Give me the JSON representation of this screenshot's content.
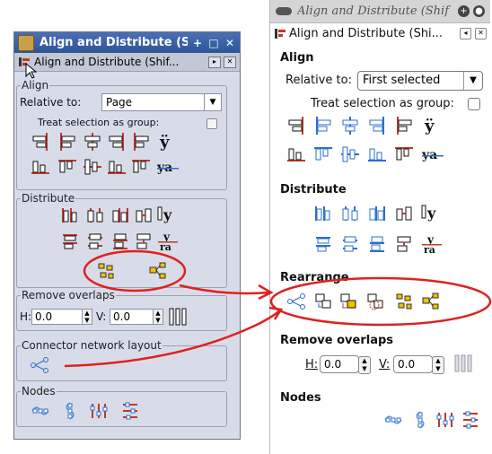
{
  "left_window": {
    "title": "Align and Distribute (Sl",
    "title_buttons": [
      "+",
      "□",
      "✕"
    ],
    "dock_title": "Align and Distribute (Shif...",
    "align": {
      "heading": "Align",
      "relative_label": "Relative to:",
      "relative_value": "Page",
      "treat_group_label": "Treat selection as group:"
    },
    "distribute": {
      "heading": "Distribute"
    },
    "remove_overlaps": {
      "heading": "Remove overlaps",
      "h_label": "H:",
      "h_value": "0.0",
      "v_label": "V:",
      "v_value": "0.0"
    },
    "connector": {
      "heading": "Connector network layout"
    },
    "nodes": {
      "heading": "Nodes"
    }
  },
  "right_window": {
    "title": "Align and Distribute (Shif",
    "dock_title": "Align and Distribute (Shi...",
    "align": {
      "heading": "Align",
      "relative_label": "Relative to:",
      "relative_value": "First selected",
      "treat_group_label": "Treat selection as group:"
    },
    "distribute": {
      "heading": "Distribute"
    },
    "rearrange": {
      "heading": "Rearrange"
    },
    "remove_overlaps": {
      "heading": "Remove overlaps",
      "h_label": "H:",
      "h_value": "0.0",
      "v_label": "V:",
      "v_value": "0.0"
    },
    "nodes": {
      "heading": "Nodes"
    }
  },
  "colors": {
    "annotation": "#e02020",
    "icon_red": "#c0392b",
    "icon_blue": "#2a6fcf",
    "icon_yellow": "#f2c200"
  }
}
